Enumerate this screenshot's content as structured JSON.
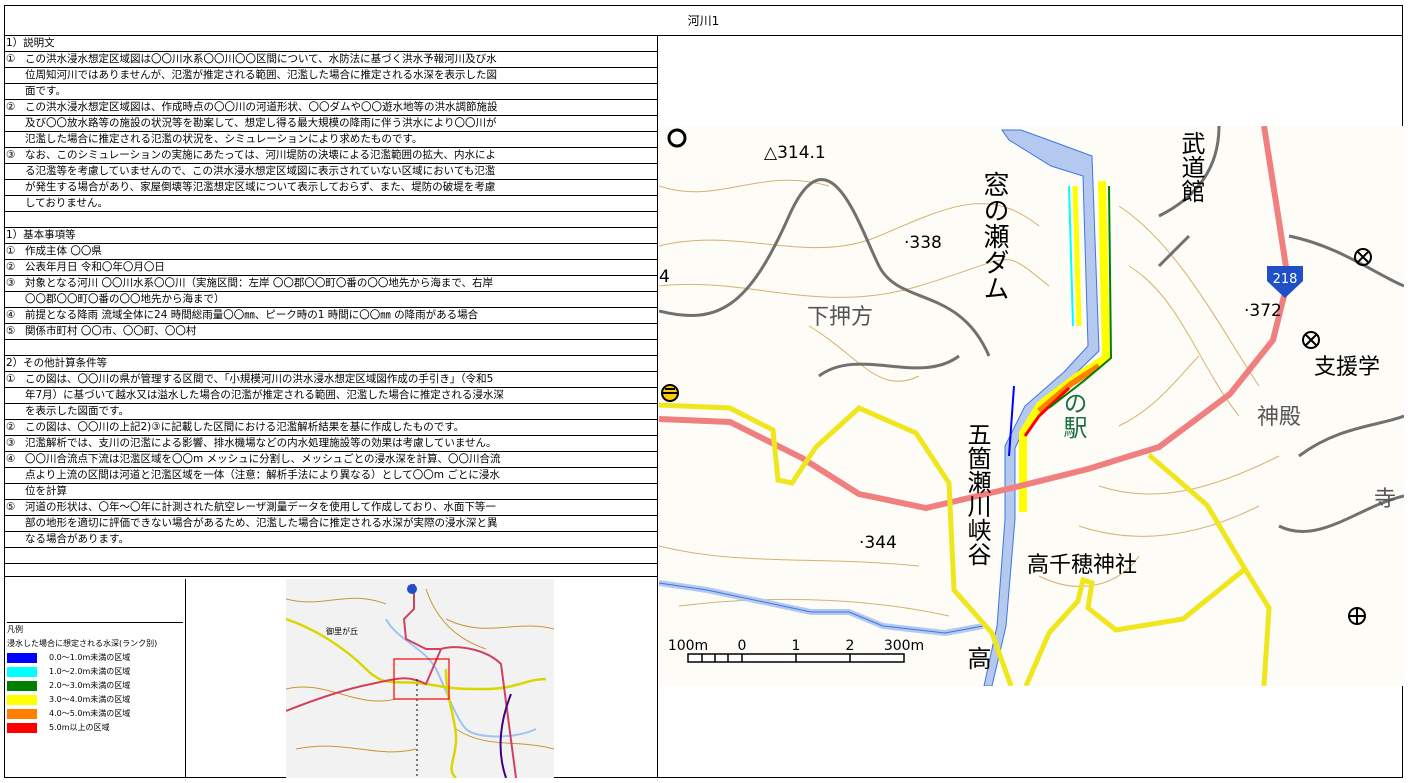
{
  "title": "河川1",
  "sections": [
    {
      "rows": [
        {
          "type": "head",
          "text": "1）説明文"
        },
        {
          "mk": "①",
          "text": "この洪水浸水想定区域図は〇〇川水系〇〇川〇〇区間について、水防法に基づく洪水予報河川及び水"
        },
        {
          "text": "位周知河川ではありませんが、氾濫が推定される範囲、氾濫した場合に推定される水深を表示した図"
        },
        {
          "text": "面です。"
        },
        {
          "mk": "②",
          "text": "この洪水浸水想定区域図は、作成時点の〇〇川の河道形状、〇〇ダムや〇〇遊水地等の洪水調節施設"
        },
        {
          "text": "及び〇〇放水路等の施設の状況等を勘案して、想定し得る最大規模の降雨に伴う洪水により〇〇川が"
        },
        {
          "text": "氾濫した場合に推定される氾濫の状況を、シミュレーションにより求めたものです。"
        },
        {
          "mk": "③",
          "text": "なお、このシミュレーションの実施にあたっては、河川堤防の決壊による氾濫範囲の拡大、内水によ"
        },
        {
          "text": "る氾濫等を考慮していませんので、この洪水浸水想定区域図に表示されていない区域においても氾濫"
        },
        {
          "text": "が発生する場合があり、家屋倒壊等氾濫想定区域について表示しておらず、また、堤防の破堤を考慮"
        },
        {
          "text": "しておりません。"
        },
        {
          "type": "blank",
          "text": ""
        },
        {
          "type": "head",
          "text": "1）基本事項等"
        },
        {
          "mk": "①",
          "text": "作成主体 〇〇県"
        },
        {
          "mk": "②",
          "text": "公表年月日 令和〇年〇月〇日"
        },
        {
          "mk": "③",
          "text": "対象となる河川 〇〇川水系〇〇川（実施区間：左岸 〇〇郡〇〇町〇番の〇〇地先から海まで、右岸"
        },
        {
          "text": "〇〇郡〇〇町〇番の〇〇地先から海まで）"
        },
        {
          "mk": "④",
          "text": "前提となる降雨 流域全体に24 時間総雨量〇〇㎜、ピーク時の1 時間に〇〇㎜ の降雨がある場合"
        },
        {
          "mk": "⑤",
          "text": "関係市町村 〇〇市、〇〇町、〇〇村"
        },
        {
          "type": "blank",
          "text": ""
        },
        {
          "type": "head",
          "text": "2）その他計算条件等"
        },
        {
          "mk": "①",
          "text": "この図は、〇〇川の県が管理する区間で、「小規模河川の洪水浸水想定区域図作成の手引き」（令和5"
        },
        {
          "text": "年7月）に基づいて越水又は溢水した場合の氾濫が推定される範囲、氾濫した場合に推定される浸水深"
        },
        {
          "text": "を表示した図面です。"
        },
        {
          "mk": "②",
          "text": "この図は、〇〇川の上記2)③に記載した区間における氾濫解析結果を基に作成したものです。"
        },
        {
          "mk": "③",
          "text": "氾濫解析では、支川の氾濫による影響、排水機場などの内水処理施設等の効果は考慮していません。"
        },
        {
          "mk": "④",
          "text": "〇〇川合流点下流は氾濫区域を〇〇m メッシュに分割し、メッシュごとの浸水深を計算、〇〇川合流"
        },
        {
          "text": "点より上流の区間は河道と氾濫区域を一体（注意：解析手法により異なる）として〇〇m ごとに浸水"
        },
        {
          "text": "位を計算"
        },
        {
          "mk": "⑤",
          "text": "河道の形状は、〇年～〇年に計測された航空レーザ測量データを使用して作成しており、水面下等一"
        },
        {
          "text": "部の地形を適切に評価できない場合があるため、氾濫した場合に推定される水深が実際の浸水深と異"
        },
        {
          "text": "なる場合があります。"
        },
        {
          "type": "blank",
          "text": ""
        },
        {
          "type": "blank last",
          "text": ""
        }
      ]
    }
  ],
  "legend": {
    "title": "凡例",
    "subtitle": "浸水した場合に想定される水深(ランク別)",
    "items": [
      {
        "label": "0.0～1.0m未満の区域",
        "color": "#0000ff"
      },
      {
        "label": "1.0～2.0m未満の区域",
        "color": "#00ffff"
      },
      {
        "label": "2.0～3.0m未満の区域",
        "color": "#008000"
      },
      {
        "label": "3.0～4.0m未満の区域",
        "color": "#ffff00"
      },
      {
        "label": "4.0～5.0m未満の区域",
        "color": "#ff8000"
      },
      {
        "label": "5.0m以上の区域",
        "color": "#ff0000"
      }
    ]
  },
  "map": {
    "labels": {
      "dam": "窓の瀬ダム",
      "budokan": "武道館",
      "elev338": "·338",
      "tri": "△314.1",
      "elev372": "·372",
      "elev344": "·344",
      "shimo": "下押方",
      "route": "218",
      "shien": "支援学",
      "shinden": "神殿",
      "eki": "の駅",
      "gorge": "五箇瀬川峡谷",
      "shrine": "高千穂神社",
      "tera": "寺",
      "taka": "高",
      "edge4": "4"
    },
    "scale": {
      "ticks": [
        "100m",
        "0",
        "1",
        "2",
        "300m"
      ]
    }
  },
  "overview": {
    "place": "御里が丘"
  }
}
